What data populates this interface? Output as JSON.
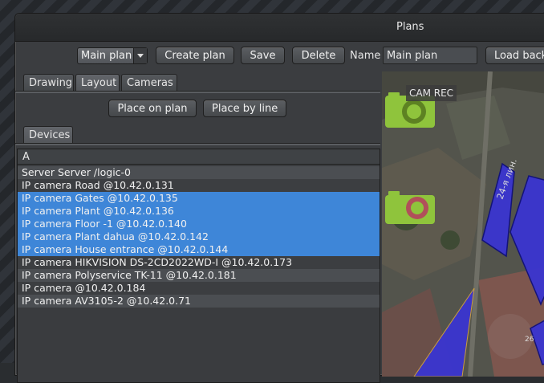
{
  "window": {
    "title": "Plans"
  },
  "toolbar": {
    "plan_select": "Main plan",
    "create_plan": "Create plan",
    "save": "Save",
    "delete": "Delete",
    "name_label": "Name",
    "name_value": "Main plan",
    "load_background": "Load back"
  },
  "tabs": [
    {
      "label": "Drawing",
      "active": false
    },
    {
      "label": "Layout",
      "active": true
    },
    {
      "label": "Cameras",
      "active": false
    }
  ],
  "layout": {
    "place_on_plan": "Place on plan",
    "place_by_line": "Place by line",
    "devices_tab": "Devices"
  },
  "device_list": {
    "header": "A",
    "rows": [
      {
        "text": "Server Server /logic-0",
        "selected": false
      },
      {
        "text": "IP camera Road  @10.42.0.131",
        "selected": false
      },
      {
        "text": "IP camera Gates  @10.42.0.135",
        "selected": true
      },
      {
        "text": "IP camera Plant  @10.42.0.136",
        "selected": true
      },
      {
        "text": "IP camera Floor -1  @10.42.0.140",
        "selected": true
      },
      {
        "text": "IP camera Plant dahua  @10.42.0.142",
        "selected": true
      },
      {
        "text": "IP camera House entrance  @10.42.0.144",
        "selected": true
      },
      {
        "text": "IP camera HIKVISION DS-2CD2022WD-I  @10.42.0.173",
        "selected": false
      },
      {
        "text": "IP camera Polyservice TK-11  @10.42.0.181",
        "selected": false
      },
      {
        "text": "IP camera   @10.42.0.184",
        "selected": false
      },
      {
        "text": "IP camera AV3105-2  @10.42.0.71",
        "selected": false
      }
    ]
  },
  "map": {
    "cam_badge": "CAM REC",
    "street_label": "24-я лин.",
    "house_number": "26",
    "icons": [
      "camera-icon",
      "camera-icon"
    ],
    "colors": {
      "selection": "#3e86d8",
      "camera_zone": "#3a35d0",
      "camera_icon": "#8fc43c"
    }
  }
}
